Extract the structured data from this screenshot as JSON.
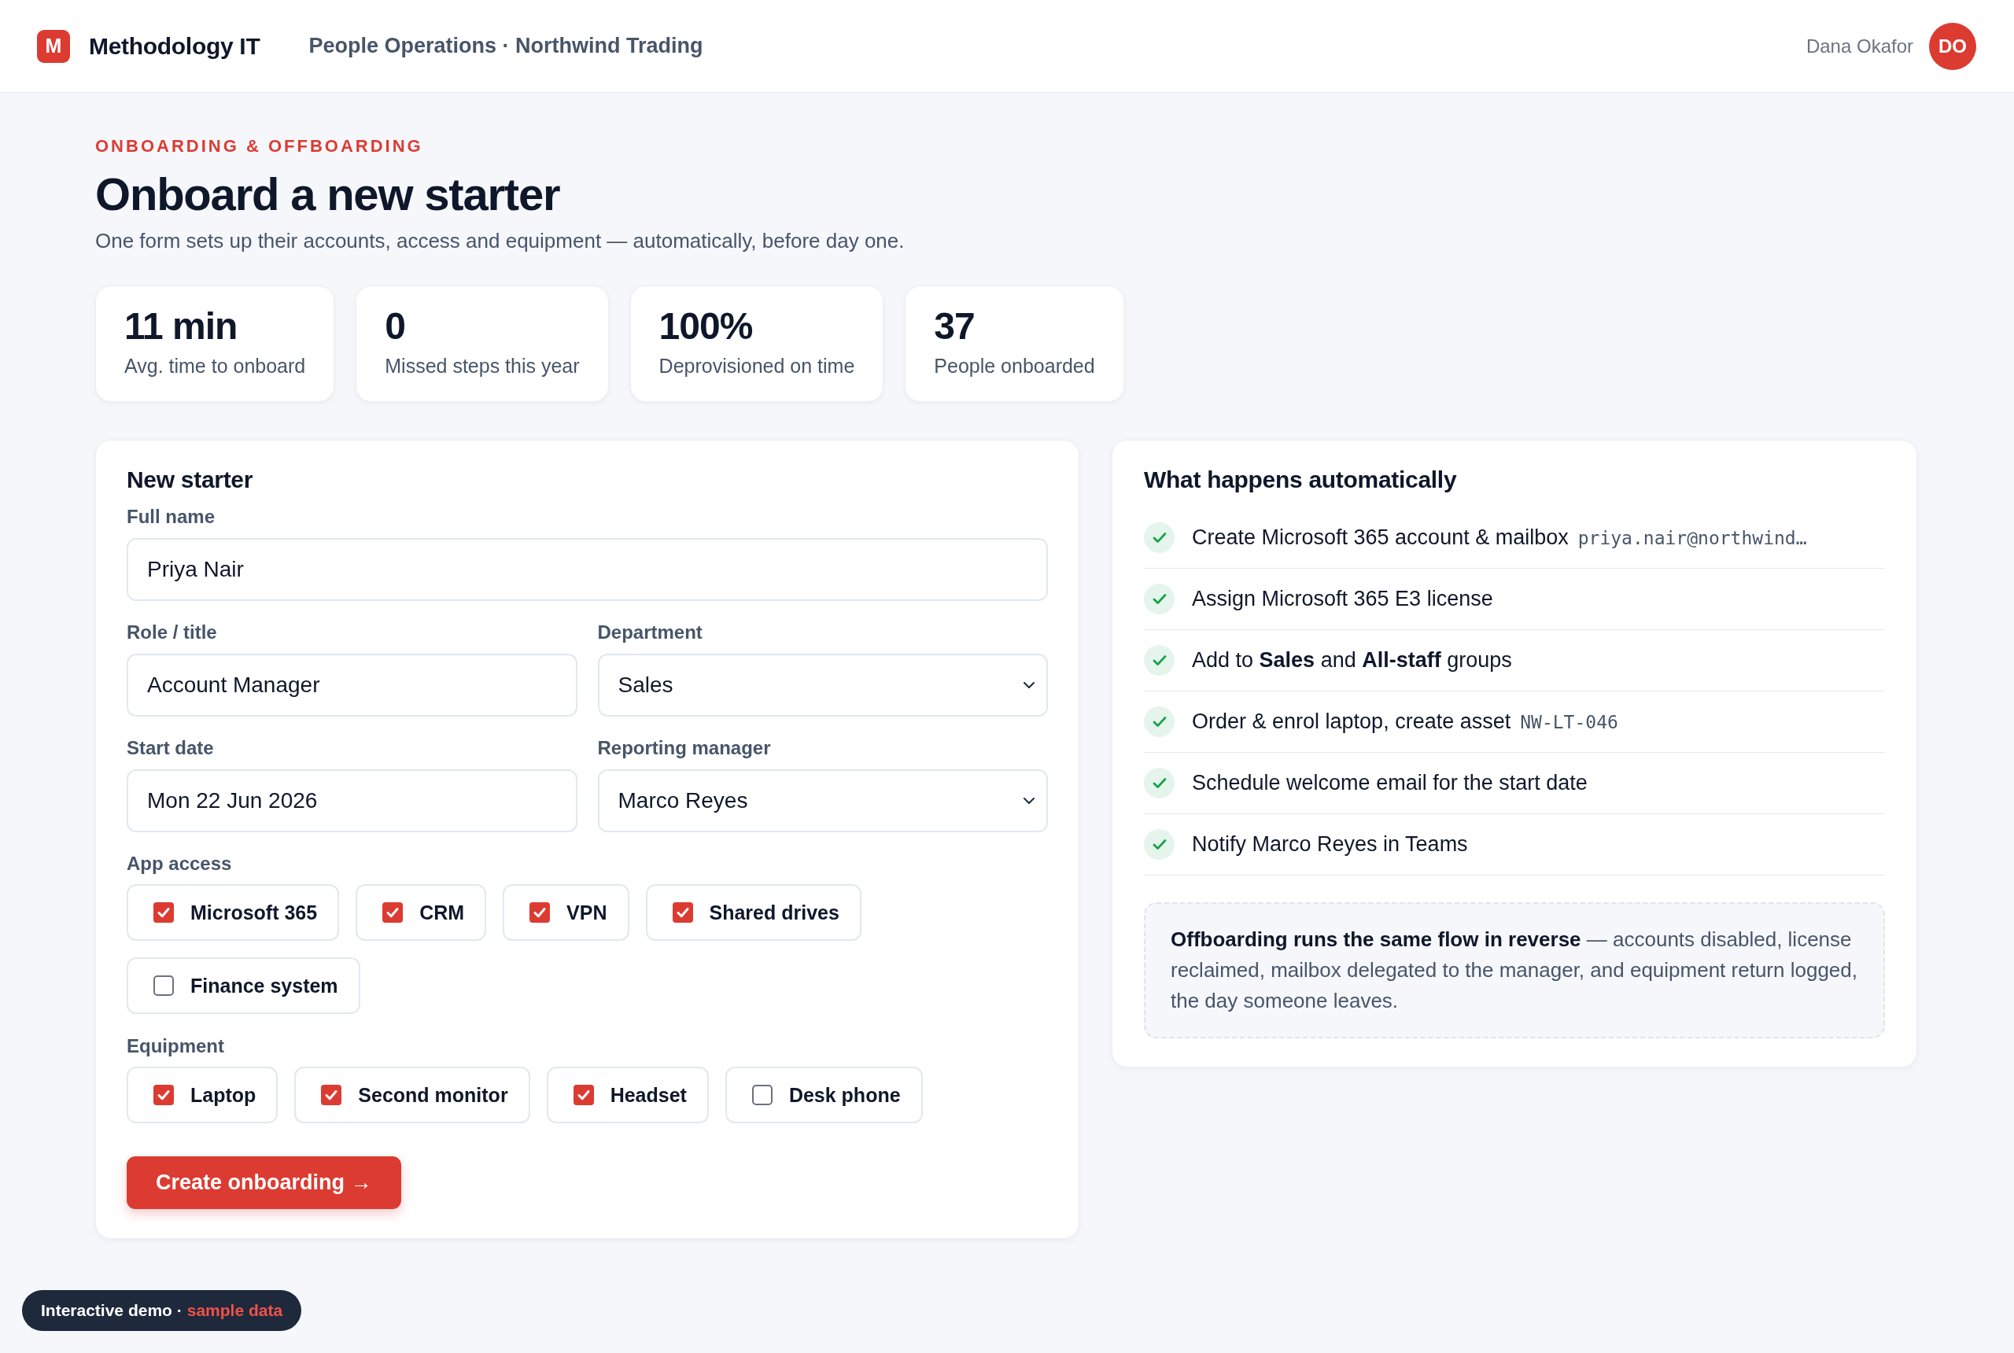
{
  "header": {
    "logo_letter": "M",
    "brand": "Methodology IT",
    "context": "People Operations · Northwind Trading",
    "user": {
      "name": "Dana Okafor",
      "initials": "DO"
    }
  },
  "page": {
    "eyebrow": "ONBOARDING & OFFBOARDING",
    "title": "Onboard a new starter",
    "subtitle": "One form sets up their accounts, access and equipment — automatically, before day one."
  },
  "stats": [
    {
      "value": "11 min",
      "label": "Avg. time to onboard"
    },
    {
      "value": "0",
      "label": "Missed steps this year"
    },
    {
      "value": "100%",
      "label": "Deprovisioned on time"
    },
    {
      "value": "37",
      "label": "People onboarded"
    }
  ],
  "form": {
    "title": "New starter",
    "rows": [
      [
        {
          "kind": "text",
          "label": "Full name",
          "value": "Priya Nair"
        }
      ],
      [
        {
          "kind": "text",
          "label": "Role / title",
          "value": "Account Manager"
        },
        {
          "kind": "select",
          "label": "Department",
          "value": "Sales"
        }
      ],
      [
        {
          "kind": "text",
          "label": "Start date",
          "value": "Mon 22 Jun 2026"
        },
        {
          "kind": "select",
          "label": "Reporting manager",
          "value": "Marco Reyes"
        }
      ]
    ],
    "groups": [
      {
        "label": "App access",
        "options": [
          {
            "label": "Microsoft 365",
            "checked": true
          },
          {
            "label": "CRM",
            "checked": true
          },
          {
            "label": "VPN",
            "checked": true
          },
          {
            "label": "Shared drives",
            "checked": true
          },
          {
            "label": "Finance system",
            "checked": false
          }
        ]
      },
      {
        "label": "Equipment",
        "options": [
          {
            "label": "Laptop",
            "checked": true
          },
          {
            "label": "Second monitor",
            "checked": true
          },
          {
            "label": "Headset",
            "checked": true
          },
          {
            "label": "Desk phone",
            "checked": false
          }
        ]
      }
    ],
    "submit": "Create onboarding →"
  },
  "automation": {
    "title": "What happens automatically",
    "steps": [
      {
        "text": "Create Microsoft 365 account & mailbox",
        "code": "priya.nair@northwind…",
        "done": true
      },
      {
        "text": "Assign Microsoft 365 E3 license",
        "done": true
      },
      {
        "text": "Add to **Sales** and **All-staff** groups",
        "done": true
      },
      {
        "text": "Order & enrol laptop, create asset",
        "code": "NW-LT-046",
        "done": true
      },
      {
        "text": "Schedule welcome email for the start date",
        "done": true
      },
      {
        "text": "Notify Marco Reyes in Teams",
        "done": true
      }
    ],
    "note": "**Offboarding runs the same flow in reverse** — accounts disabled, license reclaimed, mailbox delegated to the manager, and equipment return logged, the day someone leaves."
  },
  "demo_badge": {
    "label": "Interactive demo ·",
    "highlight": "sample data"
  }
}
